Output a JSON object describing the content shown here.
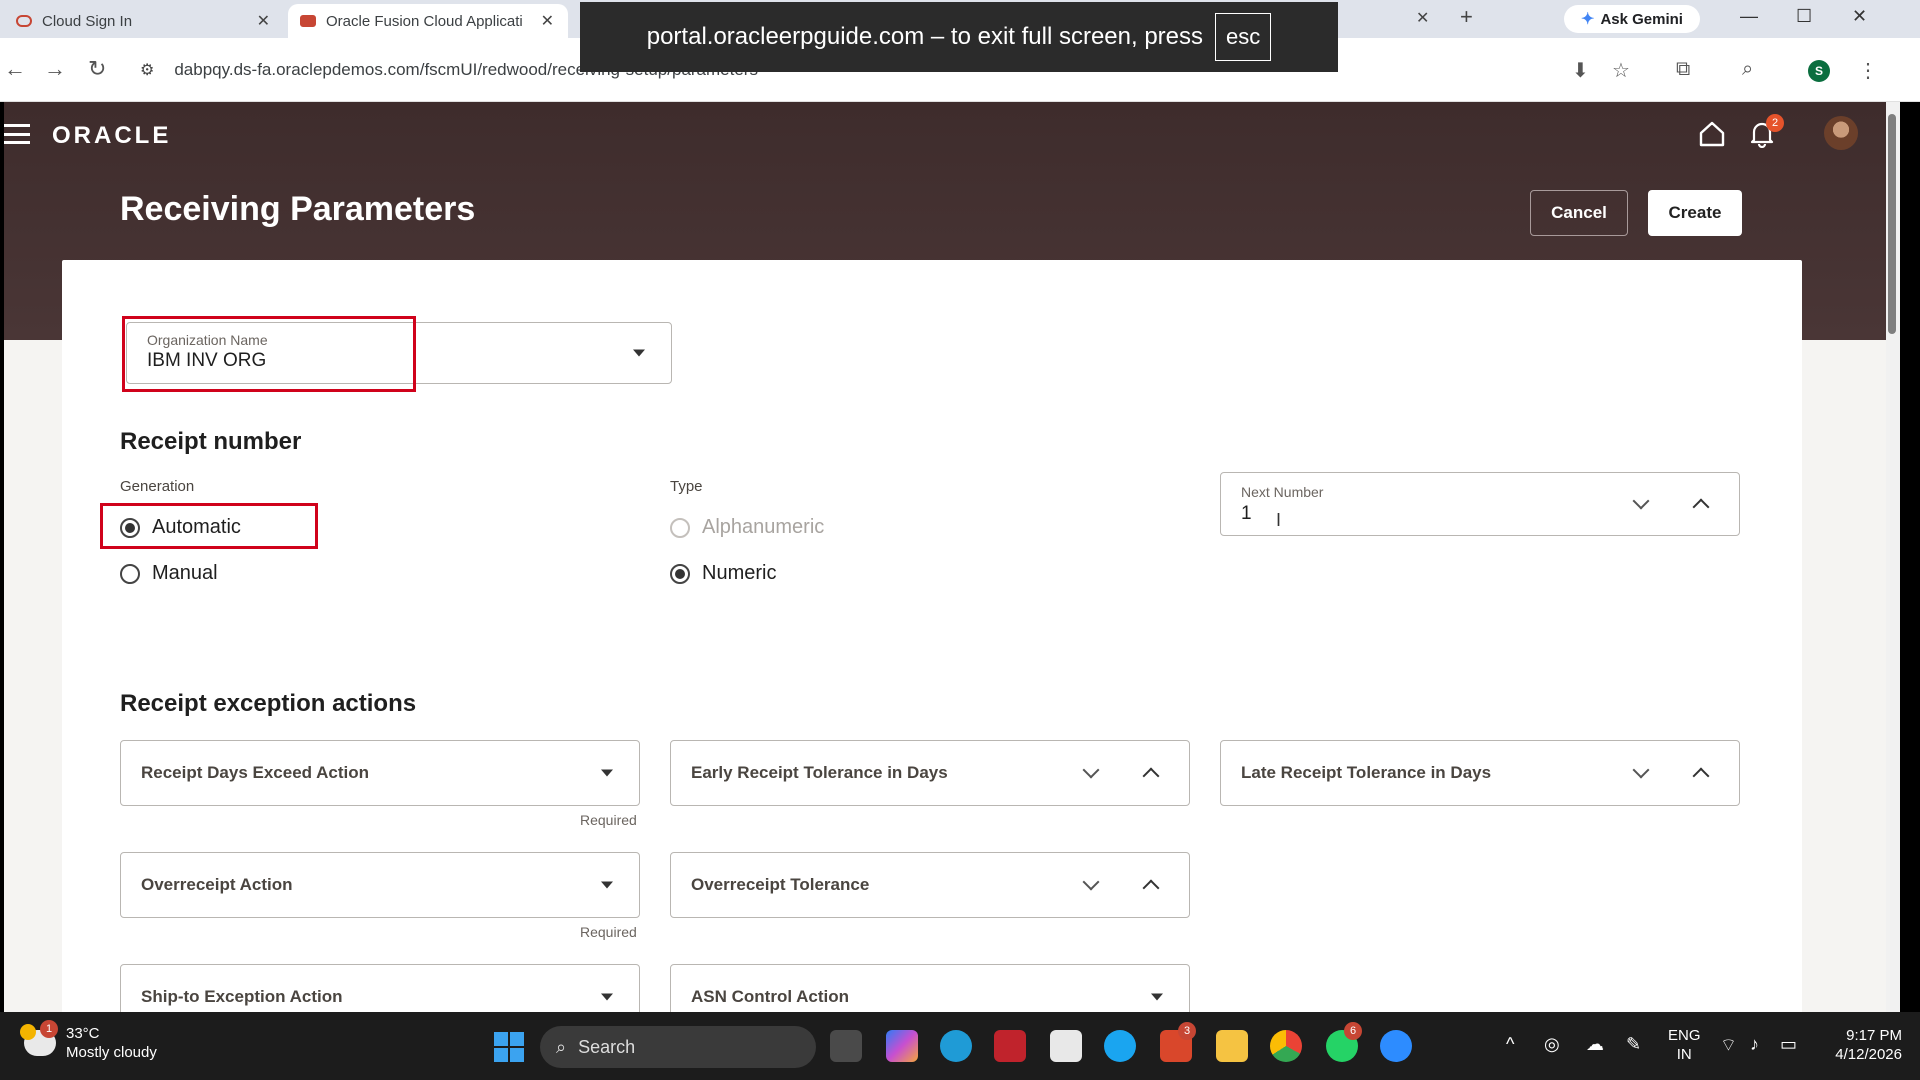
{
  "browser": {
    "tabs": [
      {
        "title": "Cloud Sign In"
      },
      {
        "title": "Oracle Fusion Cloud Applicati"
      }
    ],
    "gemini_label": "Ask Gemini",
    "url": "dabpqy.ds-fa.oraclepdemos.com/fscmUI/redwood/receiving-setup/parameters",
    "fullscreen_notice": "portal.oracleerpguide.com – to exit full screen, press",
    "fullscreen_key": "esc",
    "profile_initial": "S"
  },
  "app": {
    "logo": "ORACLE",
    "notification_count": "2",
    "page_title": "Receiving Parameters",
    "cancel_label": "Cancel",
    "create_label": "Create"
  },
  "org": {
    "label": "Organization Name",
    "value": "IBM INV ORG"
  },
  "receipt_number": {
    "section_title": "Receipt number",
    "generation_label": "Generation",
    "generation_options": [
      {
        "label": "Automatic",
        "selected": true
      },
      {
        "label": "Manual",
        "selected": false
      }
    ],
    "type_label": "Type",
    "type_options": [
      {
        "label": "Alphanumeric",
        "selected": false,
        "disabled": true
      },
      {
        "label": "Numeric",
        "selected": true,
        "disabled": false
      }
    ],
    "next_number_label": "Next Number",
    "next_number_value": "1"
  },
  "exceptions": {
    "section_title": "Receipt exception actions",
    "required_text": "Required",
    "fields": {
      "receipt_days_exceed": "Receipt Days Exceed Action",
      "early_tolerance": "Early Receipt Tolerance in Days",
      "late_tolerance": "Late Receipt Tolerance in Days",
      "overreceipt_action": "Overreceipt Action",
      "overreceipt_tolerance": "Overreceipt Tolerance",
      "ship_to_exception": "Ship-to Exception Action",
      "asn_control": "ASN Control Action"
    }
  },
  "taskbar": {
    "temperature": "33°C",
    "weather": "Mostly cloudy",
    "weather_badge": "1",
    "search_label": "Search",
    "badge_office": "3",
    "badge_whatsapp": "6",
    "lang_top": "ENG",
    "lang_bottom": "IN",
    "time": "9:17 PM",
    "date": "4/12/2026"
  },
  "colors": {
    "header_bg": "#3e2c2c",
    "highlight_red": "#d0021b",
    "card_bg": "#ffffff"
  }
}
